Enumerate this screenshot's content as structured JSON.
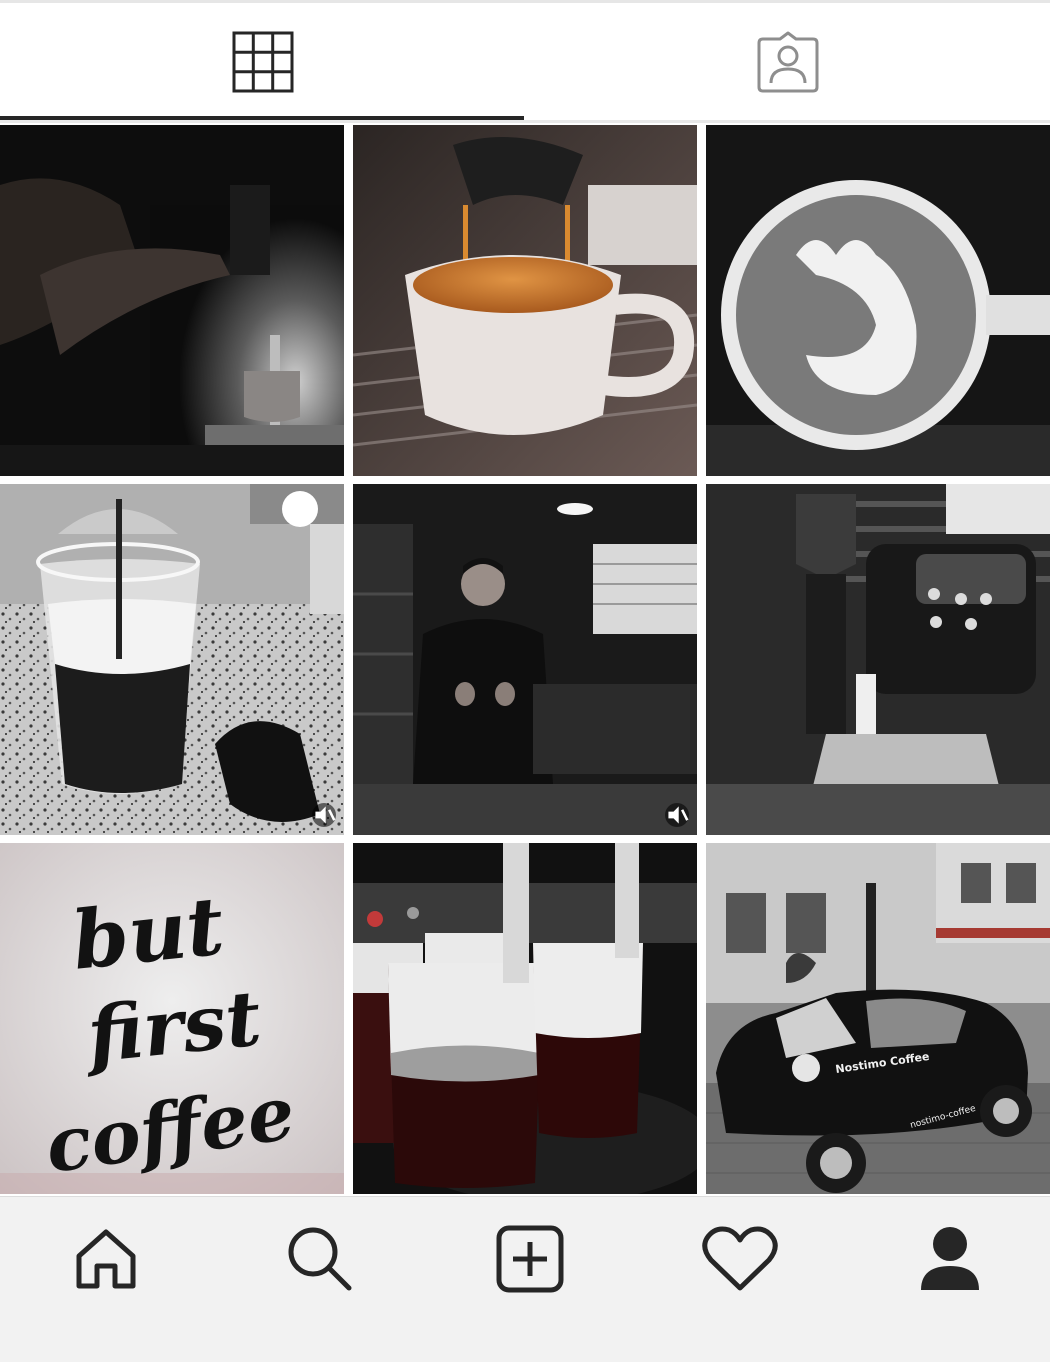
{
  "tabs": [
    {
      "id": "grid",
      "icon": "grid-icon",
      "active": true
    },
    {
      "id": "tagged",
      "icon": "tagged-person-icon",
      "active": false
    }
  ],
  "posts": [
    {
      "id": 1,
      "subject": "barista-pulling-espresso",
      "tone": "dark"
    },
    {
      "id": 2,
      "subject": "espresso-cup-under-portafilter",
      "tone": "warm"
    },
    {
      "id": 3,
      "subject": "latte-art-swan",
      "tone": "mono"
    },
    {
      "id": 4,
      "subject": "iced-coffee-cup",
      "tone": "mono",
      "video": true
    },
    {
      "id": 5,
      "subject": "barista-thumbs-up",
      "tone": "dark",
      "video": true
    },
    {
      "id": 6,
      "subject": "espresso-machine-grinder",
      "tone": "mono"
    },
    {
      "id": 7,
      "subject": "but-first-coffee-text",
      "tone": "light",
      "text_lines": [
        "but",
        "first",
        "coffee"
      ]
    },
    {
      "id": 8,
      "subject": "layered-cold-drinks",
      "tone": "dark"
    },
    {
      "id": 9,
      "subject": "branded-mini-car",
      "tone": "mono",
      "car_text": "Nostimo Coffee",
      "handle": "nostimo-coffee"
    }
  ],
  "bottom_nav": [
    {
      "id": "home",
      "icon": "home-icon"
    },
    {
      "id": "search",
      "icon": "search-icon"
    },
    {
      "id": "new-post",
      "icon": "add-post-icon"
    },
    {
      "id": "activity",
      "icon": "heart-icon"
    },
    {
      "id": "profile",
      "icon": "profile-icon"
    }
  ],
  "colors": {
    "icon_dark": "#262626",
    "icon_grey": "#8e8e8e",
    "nav_background": "#f2f2f2",
    "tab_underline": "#262626"
  }
}
